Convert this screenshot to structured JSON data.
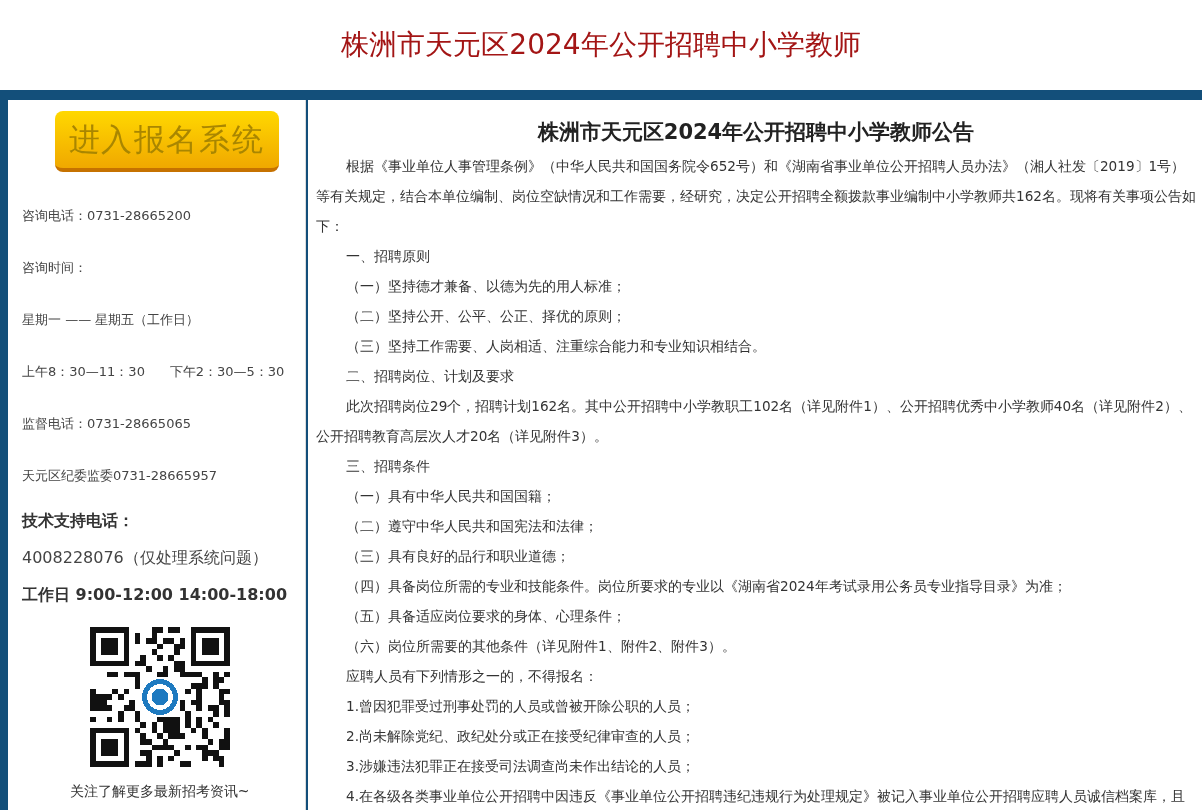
{
  "header": {
    "title": "株洲市天元区2024年公开招聘中小学教师"
  },
  "sidebar": {
    "register_button": "进入报名系统",
    "info": [
      {
        "text": "咨询电话：0731-28665200",
        "kind": "small",
        "bold": false
      },
      {
        "text": "咨询时间：",
        "kind": "small",
        "bold": false
      },
      {
        "text": "星期一 —— 星期五（工作日）",
        "kind": "small",
        "bold": false
      },
      {
        "text": "上午8：30—11：30      下午2：30—5：30",
        "kind": "small",
        "bold": false
      },
      {
        "text": "监督电话：0731-28665065",
        "kind": "small",
        "bold": false
      },
      {
        "text": "天元区纪委监委0731-28665957",
        "kind": "small",
        "bold": false
      },
      {
        "text": "技术支持电话：",
        "kind": "large",
        "bold": true
      },
      {
        "text": "4008228076（仅处理系统问题）",
        "kind": "large",
        "bold": false
      },
      {
        "text": "工作日 9:00-12:00 14:00-18:00",
        "kind": "large",
        "bold": true
      }
    ],
    "qr_caption": "关注了解更多最新招考资讯~"
  },
  "article": {
    "title": "株洲市天元区2024年公开招聘中小学教师公告",
    "paragraphs": [
      "根据《事业单位人事管理条例》（中华人民共和国国务院令652号）和《湖南省事业单位公开招聘人员办法》（湘人社发〔2019〕1号）等有关规定，结合本单位编制、岗位空缺情况和工作需要，经研究，决定公开招聘全额拨款事业编制中小学教师共162名。现将有关事项公告如下：",
      "一、招聘原则",
      "（一）坚持德才兼备、以德为先的用人标准；",
      "（二）坚持公开、公平、公正、择优的原则；",
      "（三）坚持工作需要、人岗相适、注重综合能力和专业知识相结合。",
      "二、招聘岗位、计划及要求",
      "此次招聘岗位29个，招聘计划162名。其中公开招聘中小学教职工102名（详见附件1）、公开招聘优秀中小学教师40名（详见附件2）、公开招聘教育高层次人才20名（详见附件3）。",
      "三、招聘条件",
      "（一）具有中华人民共和国国籍；",
      "（二）遵守中华人民共和国宪法和法律；",
      "（三）具有良好的品行和职业道德；",
      "（四）具备岗位所需的专业和技能条件。岗位所要求的专业以《湖南省2024年考试录用公务员专业指导目录》为准；",
      "（五）具备适应岗位要求的身体、心理条件；",
      "（六）岗位所需要的其他条件（详见附件1、附件2、附件3）。",
      "应聘人员有下列情形之一的，不得报名：",
      "1.曾因犯罪受过刑事处罚的人员或曾被开除公职的人员；",
      "2.尚未解除党纪、政纪处分或正在接受纪律审查的人员；",
      "3.涉嫌违法犯罪正在接受司法调查尚未作出结论的人员；",
      "4.在各级各类事业单位公开招聘中因违反《事业单位公开招聘违纪违规行为处理规定》被记入事业单位公开招聘应聘人员诚信档案库，且"
    ]
  }
}
